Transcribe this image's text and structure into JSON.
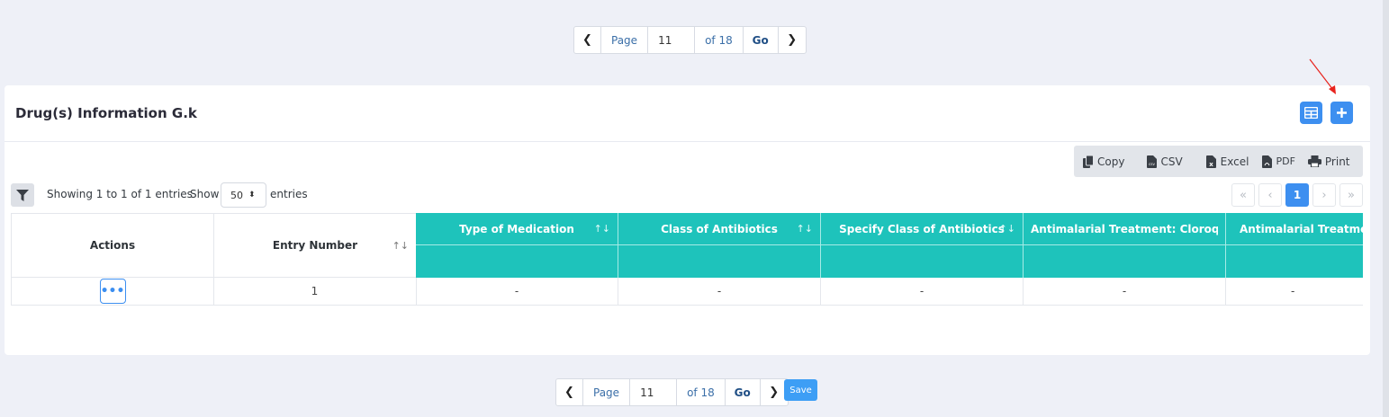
{
  "pager_top": {
    "prev_icon": "chevron-left-icon",
    "page_label": "Page",
    "page_value": "11",
    "of_label": "of 18",
    "go_label": "Go",
    "next_icon": "chevron-right-icon"
  },
  "pager_bottom": {
    "prev_icon": "chevron-left-icon",
    "page_label": "Page",
    "page_value": "11",
    "of_label": "of 18",
    "go_label": "Go",
    "next_icon": "chevron-right-icon",
    "save_label": "Save"
  },
  "card": {
    "title": "Drug(s) Information G.k",
    "header_buttons": [
      "table-view-icon",
      "plus-icon"
    ]
  },
  "export": {
    "buttons": [
      {
        "label": "Copy",
        "icon": "copy-icon"
      },
      {
        "label": "CSV",
        "icon": "csv-file-icon"
      },
      {
        "label": "Excel",
        "icon": "excel-file-icon"
      },
      {
        "label": "PDF",
        "icon": "pdf-file-icon"
      },
      {
        "label": "Print",
        "icon": "print-icon"
      }
    ]
  },
  "table_controls": {
    "info": "Showing 1 to 1 of 1 entries",
    "show_label": "Show",
    "show_value": "50",
    "entries_label": "entries",
    "pagination": [
      "«",
      "‹",
      "1",
      "›",
      "»"
    ],
    "active_page": "1"
  },
  "table": {
    "columns": [
      "Actions",
      "Entry Number",
      "Type of Medication",
      "Class of Antibiotics",
      "Specify Class of Antibiotics",
      "Antimalarial Treatment: Cloroquine",
      "Antimalarial Treatment"
    ],
    "sort_icon": "↑↓",
    "rows": [
      {
        "actions": "•••",
        "entry_number": "1",
        "type_of_medication": "-",
        "class_of_antibiotics": "-",
        "specify_class": "-",
        "antimalarial_cloroquine": "-",
        "antimalarial_treatment": "-"
      }
    ]
  },
  "colors": {
    "accent": "#3d8ff0",
    "table_header": "#1ec3bb",
    "page_bg": "#eef0f7",
    "annotation_arrow": "#e8231d"
  }
}
